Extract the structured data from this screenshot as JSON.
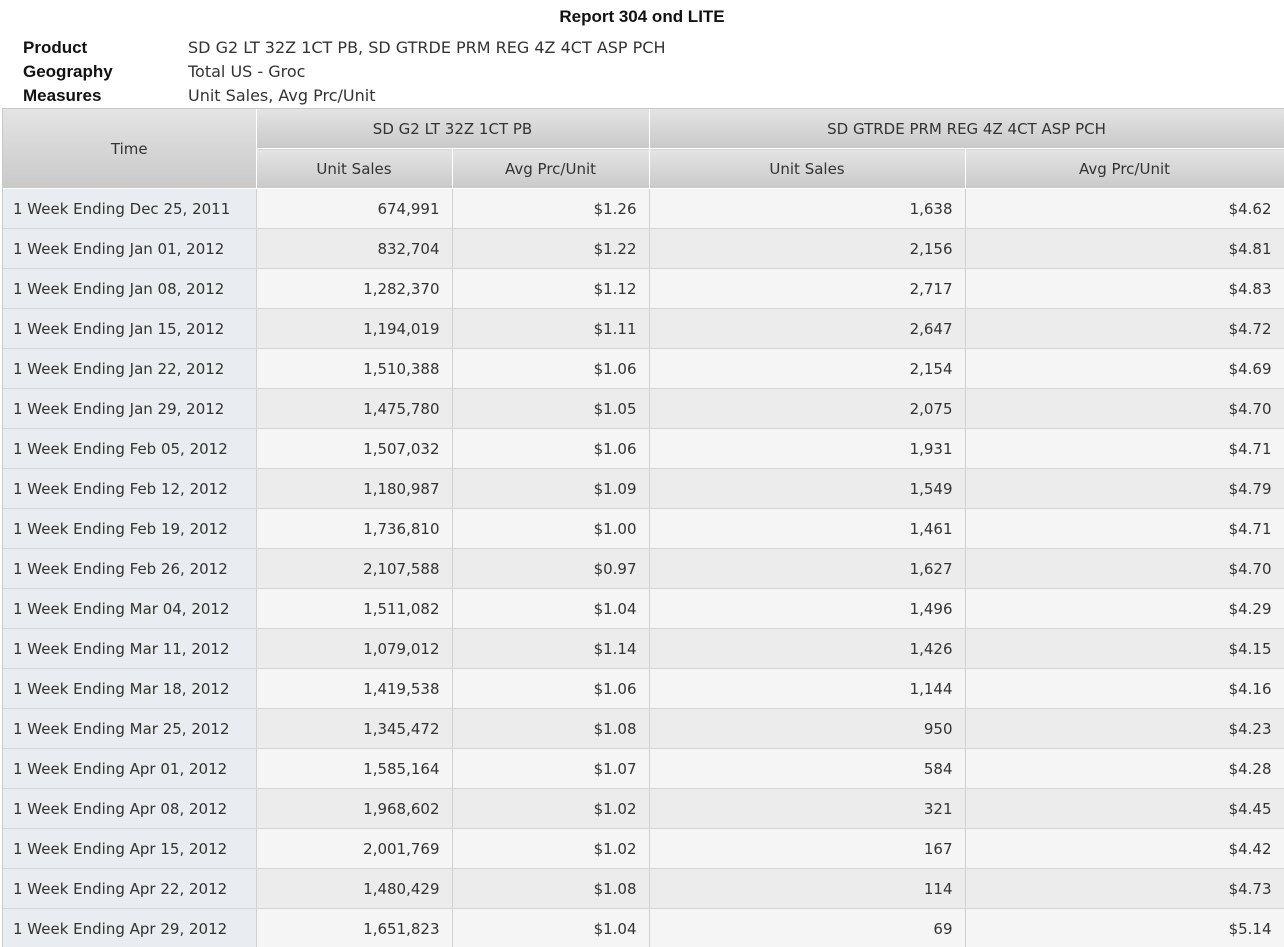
{
  "report": {
    "title": "Report 304 ond LITE"
  },
  "meta": {
    "product_label": "Product",
    "product_value": "SD G2 LT 32Z 1CT PB, SD GTRDE PRM REG 4Z 4CT ASP PCH",
    "geography_label": "Geography",
    "geography_value": "Total US - Groc",
    "measures_label": "Measures",
    "measures_value": "Unit Sales, Avg Prc/Unit"
  },
  "table": {
    "time_header": "Time",
    "groups": [
      {
        "name": "SD G2 LT 32Z 1CT PB",
        "measures": [
          "Unit Sales",
          "Avg Prc/Unit"
        ]
      },
      {
        "name": "SD GTRDE PRM REG 4Z 4CT ASP PCH",
        "measures": [
          "Unit Sales",
          "Avg Prc/Unit"
        ]
      }
    ],
    "rows": [
      {
        "time": "1 Week Ending Dec 25, 2011",
        "g1_units": "674,991",
        "g1_price": "$1.26",
        "g2_units": "1,638",
        "g2_price": "$4.62"
      },
      {
        "time": "1 Week Ending Jan 01, 2012",
        "g1_units": "832,704",
        "g1_price": "$1.22",
        "g2_units": "2,156",
        "g2_price": "$4.81"
      },
      {
        "time": "1 Week Ending Jan 08, 2012",
        "g1_units": "1,282,370",
        "g1_price": "$1.12",
        "g2_units": "2,717",
        "g2_price": "$4.83"
      },
      {
        "time": "1 Week Ending Jan 15, 2012",
        "g1_units": "1,194,019",
        "g1_price": "$1.11",
        "g2_units": "2,647",
        "g2_price": "$4.72"
      },
      {
        "time": "1 Week Ending Jan 22, 2012",
        "g1_units": "1,510,388",
        "g1_price": "$1.06",
        "g2_units": "2,154",
        "g2_price": "$4.69"
      },
      {
        "time": "1 Week Ending Jan 29, 2012",
        "g1_units": "1,475,780",
        "g1_price": "$1.05",
        "g2_units": "2,075",
        "g2_price": "$4.70"
      },
      {
        "time": "1 Week Ending Feb 05, 2012",
        "g1_units": "1,507,032",
        "g1_price": "$1.06",
        "g2_units": "1,931",
        "g2_price": "$4.71"
      },
      {
        "time": "1 Week Ending Feb 12, 2012",
        "g1_units": "1,180,987",
        "g1_price": "$1.09",
        "g2_units": "1,549",
        "g2_price": "$4.79"
      },
      {
        "time": "1 Week Ending Feb 19, 2012",
        "g1_units": "1,736,810",
        "g1_price": "$1.00",
        "g2_units": "1,461",
        "g2_price": "$4.71"
      },
      {
        "time": "1 Week Ending Feb 26, 2012",
        "g1_units": "2,107,588",
        "g1_price": "$0.97",
        "g2_units": "1,627",
        "g2_price": "$4.70"
      },
      {
        "time": "1 Week Ending Mar 04, 2012",
        "g1_units": "1,511,082",
        "g1_price": "$1.04",
        "g2_units": "1,496",
        "g2_price": "$4.29"
      },
      {
        "time": "1 Week Ending Mar 11, 2012",
        "g1_units": "1,079,012",
        "g1_price": "$1.14",
        "g2_units": "1,426",
        "g2_price": "$4.15"
      },
      {
        "time": "1 Week Ending Mar 18, 2012",
        "g1_units": "1,419,538",
        "g1_price": "$1.06",
        "g2_units": "1,144",
        "g2_price": "$4.16"
      },
      {
        "time": "1 Week Ending Mar 25, 2012",
        "g1_units": "1,345,472",
        "g1_price": "$1.08",
        "g2_units": "950",
        "g2_price": "$4.23"
      },
      {
        "time": "1 Week Ending Apr 01, 2012",
        "g1_units": "1,585,164",
        "g1_price": "$1.07",
        "g2_units": "584",
        "g2_price": "$4.28"
      },
      {
        "time": "1 Week Ending Apr 08, 2012",
        "g1_units": "1,968,602",
        "g1_price": "$1.02",
        "g2_units": "321",
        "g2_price": "$4.45"
      },
      {
        "time": "1 Week Ending Apr 15, 2012",
        "g1_units": "2,001,769",
        "g1_price": "$1.02",
        "g2_units": "167",
        "g2_price": "$4.42"
      },
      {
        "time": "1 Week Ending Apr 22, 2012",
        "g1_units": "1,480,429",
        "g1_price": "$1.08",
        "g2_units": "114",
        "g2_price": "$4.73"
      },
      {
        "time": "1 Week Ending Apr 29, 2012",
        "g1_units": "1,651,823",
        "g1_price": "$1.04",
        "g2_units": "69",
        "g2_price": "$5.14"
      }
    ]
  }
}
